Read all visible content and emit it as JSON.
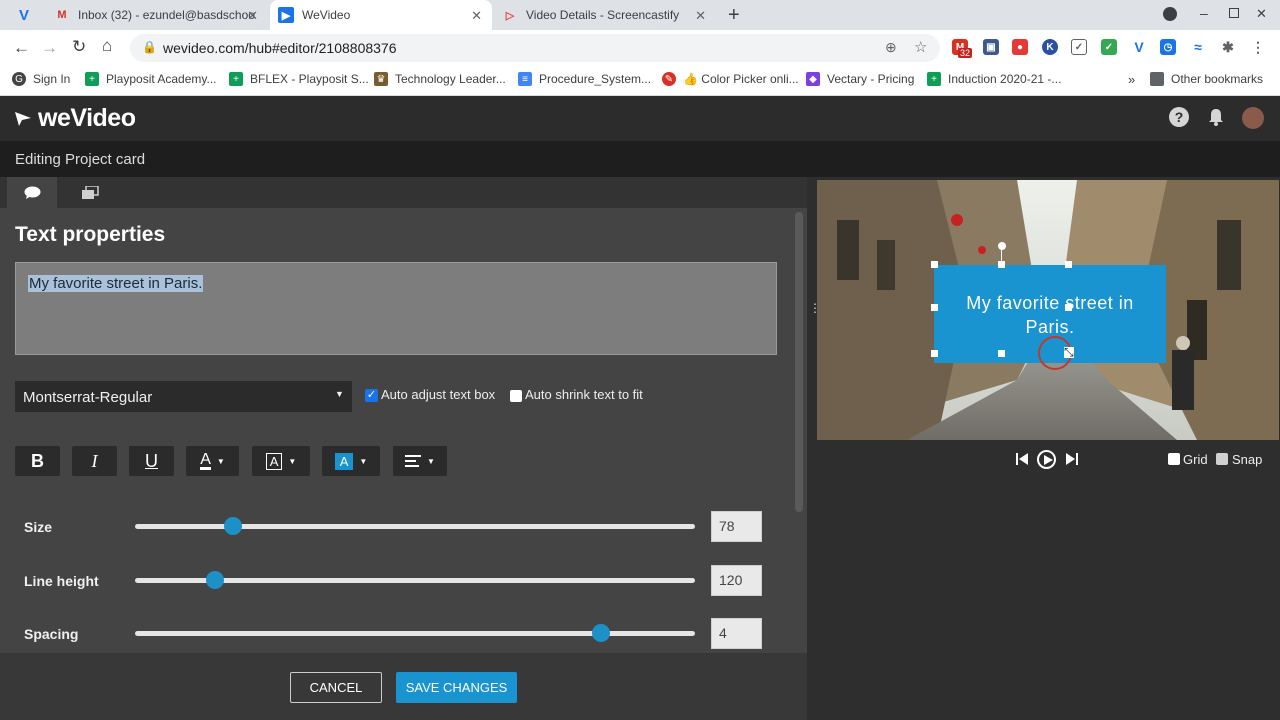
{
  "browser": {
    "tabs": [
      {
        "title": "",
        "icon": "v-icon"
      },
      {
        "title": "Inbox (32) - ezundel@basdschoo",
        "icon": "gmail-icon"
      },
      {
        "title": "WeVideo",
        "icon": "wevideo-icon"
      },
      {
        "title": "Video Details - Screencastify",
        "icon": "screencastify-icon"
      }
    ],
    "url": "wevideo.com/hub#editor/2108808376",
    "bookmarks": [
      {
        "label": "Sign In",
        "color": "#444444"
      },
      {
        "label": "Playposit Academy...",
        "color": "#0f9d58"
      },
      {
        "label": "BFLEX - Playposit S...",
        "color": "#0f9d58"
      },
      {
        "label": "Technology Leader...",
        "color": "#7a5c2e"
      },
      {
        "label": "Procedure_System...",
        "color": "#4285f4"
      },
      {
        "label": "👍 Color Picker onli...",
        "color": "#d93025"
      },
      {
        "label": "Vectary - Pricing",
        "color": "#7b3fe4"
      },
      {
        "label": "Induction 2020-21 -...",
        "color": "#0f9d58"
      }
    ],
    "more_bookmarks": "»",
    "other_bookmarks": "Other bookmarks",
    "gmail_badge": "32"
  },
  "app": {
    "logo": "weVideo",
    "subheader": "Editing Project card",
    "section_title": "Text properties",
    "text_content": "My favorite street in Paris.",
    "font": "Montserrat-Regular",
    "auto_adjust_label": "Auto adjust text box",
    "auto_adjust_checked": true,
    "auto_shrink_label": "Auto shrink text to fit",
    "auto_shrink_checked": false,
    "format": {
      "bold": "B",
      "italic": "I",
      "underline": "U",
      "color_a": "A"
    },
    "sliders": [
      {
        "label": "Size",
        "value": "78",
        "fraction": 0.175
      },
      {
        "label": "Line height",
        "value": "120",
        "fraction": 0.142
      },
      {
        "label": "Spacing",
        "value": "4",
        "fraction": 0.832
      }
    ],
    "cancel": "CANCEL",
    "save": "SAVE CHANGES",
    "preview_text": "My favorite street in Paris.",
    "grid_label": "Grid",
    "snap_label": "Snap",
    "accent": "#1a93d1"
  }
}
